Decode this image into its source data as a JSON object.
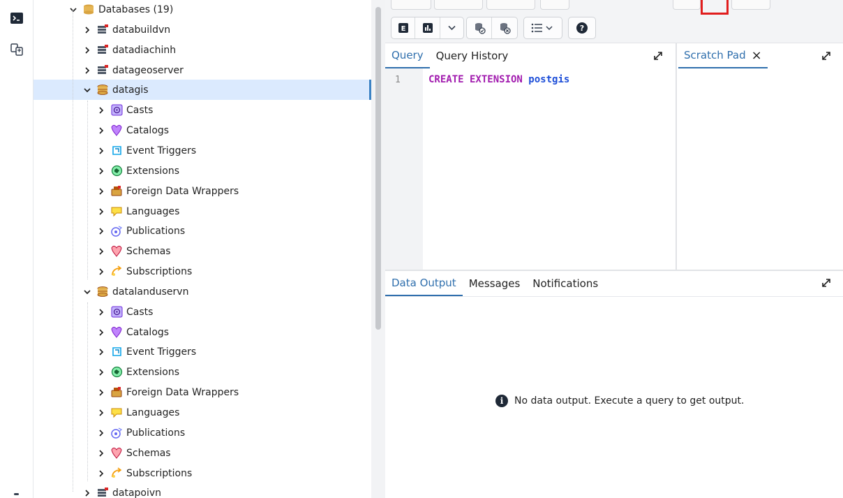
{
  "tree": {
    "databases_label": "Databases (19)",
    "databases": [
      {
        "label": "databuildvn",
        "expanded": false
      },
      {
        "label": "datadiachinh",
        "expanded": false
      },
      {
        "label": "datageoserver",
        "expanded": false
      },
      {
        "label": "datagis",
        "expanded": true,
        "selected": true,
        "children": [
          "Casts",
          "Catalogs",
          "Event Triggers",
          "Extensions",
          "Foreign Data Wrappers",
          "Languages",
          "Publications",
          "Schemas",
          "Subscriptions"
        ]
      },
      {
        "label": "datalanduservn",
        "expanded": true,
        "children": [
          "Casts",
          "Catalogs",
          "Event Triggers",
          "Extensions",
          "Foreign Data Wrappers",
          "Languages",
          "Publications",
          "Schemas",
          "Subscriptions"
        ]
      },
      {
        "label": "datapoivn",
        "expanded": false
      }
    ]
  },
  "query_tabs": {
    "query": "Query",
    "history": "Query History"
  },
  "scratch_pad": {
    "label": "Scratch Pad",
    "close": "×"
  },
  "editor": {
    "line_number": "1",
    "keyword": "CREATE EXTENSION",
    "identifier": "postgis"
  },
  "output_tabs": {
    "data_output": "Data Output",
    "messages": "Messages",
    "notifications": "Notifications"
  },
  "output": {
    "empty_message": "No data output. Execute a query to get output.",
    "info_glyph": "i"
  },
  "colors": {
    "accent": "#2f6fad",
    "selected_row": "#dbeafe",
    "keyword": "#a21caf",
    "identifier": "#1d4ed8",
    "highlight_box": "#e11d1d"
  }
}
